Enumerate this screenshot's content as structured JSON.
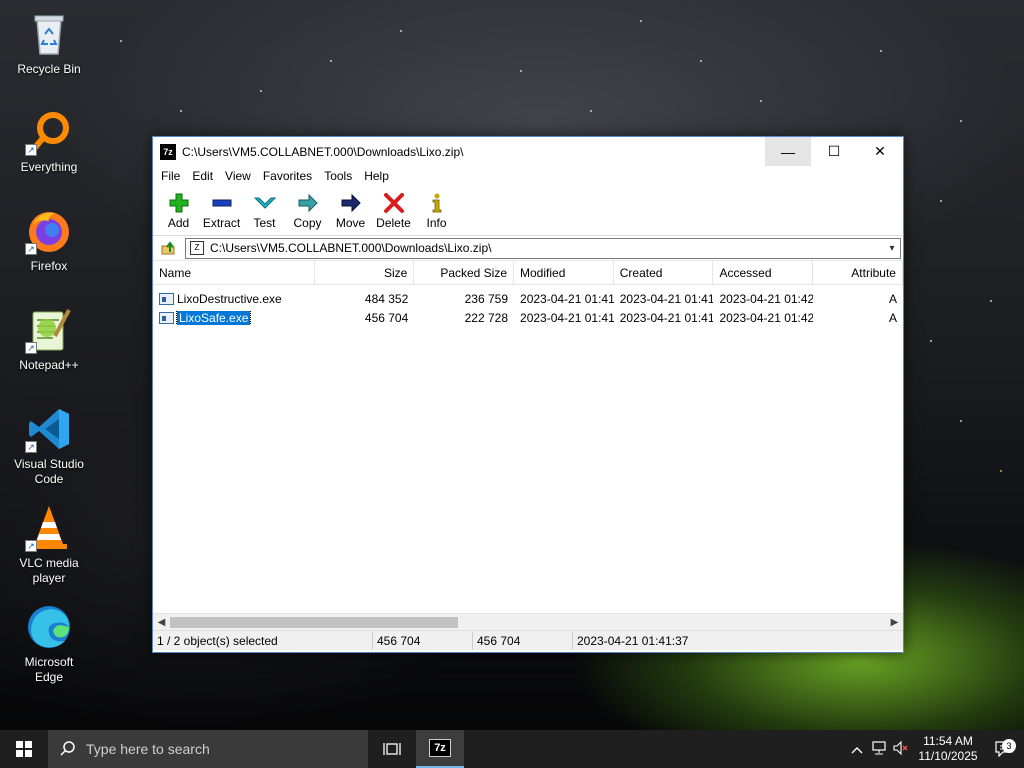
{
  "desktop": {
    "icons": [
      {
        "label": "Recycle Bin"
      },
      {
        "label": "Everything"
      },
      {
        "label": "Firefox"
      },
      {
        "label": "Notepad++"
      },
      {
        "label": "Visual Studio Code"
      },
      {
        "label": "VLC media player"
      },
      {
        "label": "Microsoft Edge"
      }
    ]
  },
  "window": {
    "title": "C:\\Users\\VM5.COLLABNET.000\\Downloads\\Lixo.zip\\",
    "app_icon_text": "7z",
    "controls": {
      "minimize": "—",
      "maximize": "☐",
      "close": "✕"
    },
    "menu": [
      "File",
      "Edit",
      "View",
      "Favorites",
      "Tools",
      "Help"
    ],
    "toolbar": [
      {
        "label": "Add",
        "icon": "plus-icon",
        "color": "#1fb31f"
      },
      {
        "label": "Extract",
        "icon": "minus-icon",
        "color": "#1a3fbf"
      },
      {
        "label": "Test",
        "icon": "check-chevron-icon",
        "color": "#21b5c8"
      },
      {
        "label": "Copy",
        "icon": "arrow-right-icon",
        "color": "#3aa0a8"
      },
      {
        "label": "Move",
        "icon": "arrow-right-icon",
        "color": "#1a2a6c"
      },
      {
        "label": "Delete",
        "icon": "x-icon",
        "color": "#d91d1d"
      },
      {
        "label": "Info",
        "icon": "info-icon",
        "color": "#c9a800"
      }
    ],
    "address": "C:\\Users\\VM5.COLLABNET.000\\Downloads\\Lixo.zip\\",
    "columns": {
      "name": "Name",
      "size": "Size",
      "packed": "Packed Size",
      "modified": "Modified",
      "created": "Created",
      "accessed": "Accessed",
      "attributes": "Attribute"
    },
    "files": [
      {
        "name": "LixoDestructive.exe",
        "size": "484 352",
        "packed": "236 759",
        "modified": "2023-04-21 01:41",
        "created": "2023-04-21 01:41",
        "accessed": "2023-04-21 01:42",
        "attributes": "A",
        "selected": false
      },
      {
        "name": "LixoSafe.exe",
        "size": "456 704",
        "packed": "222 728",
        "modified": "2023-04-21 01:41",
        "created": "2023-04-21 01:41",
        "accessed": "2023-04-21 01:42",
        "attributes": "A",
        "selected": true
      }
    ],
    "status": {
      "selection": "1 / 2 object(s) selected",
      "size": "456 704",
      "packed": "456 704",
      "modified": "2023-04-21 01:41:37"
    }
  },
  "taskbar": {
    "search_placeholder": "Type here to search",
    "clock_time": "11:54 AM",
    "clock_date": "11/10/2025",
    "notification_count": "3"
  }
}
